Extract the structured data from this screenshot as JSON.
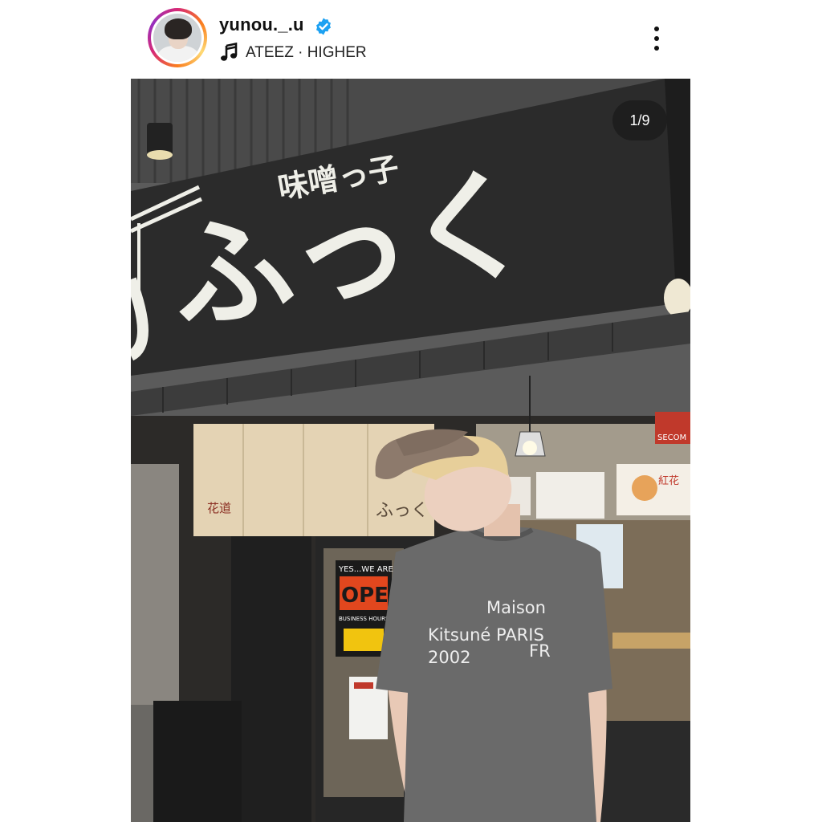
{
  "post": {
    "username": "yunou._.u",
    "song": "ATEEZ · HIGHER",
    "counter": "1/9"
  },
  "photo": {
    "sign": {
      "small_text": "味噌っ子",
      "big_text": "ふっく"
    },
    "noren_text": "ふっく",
    "noren_side": "花道",
    "door_sign_top": "YES...WE ARE",
    "door_sign_big": "OPEN",
    "door_sign_small": "BUSINESS HOURS",
    "shirt": {
      "line1": "Maison",
      "line2": "Kitsuné PARIS",
      "line3": "2002",
      "line4": "FR"
    },
    "window_poster": "紅花",
    "red_badge": "SECOM"
  },
  "icons": {
    "verified": "verified-badge-icon",
    "music": "music-note-icon",
    "more": "more-options-icon"
  },
  "colors": {
    "verified_blue": "#1da1f2",
    "sign_black": "#2b2b2b",
    "noren_beige": "#e4d3b4",
    "shirt_gray": "#6a6a6a",
    "cap_brown": "#8d7a6c"
  }
}
